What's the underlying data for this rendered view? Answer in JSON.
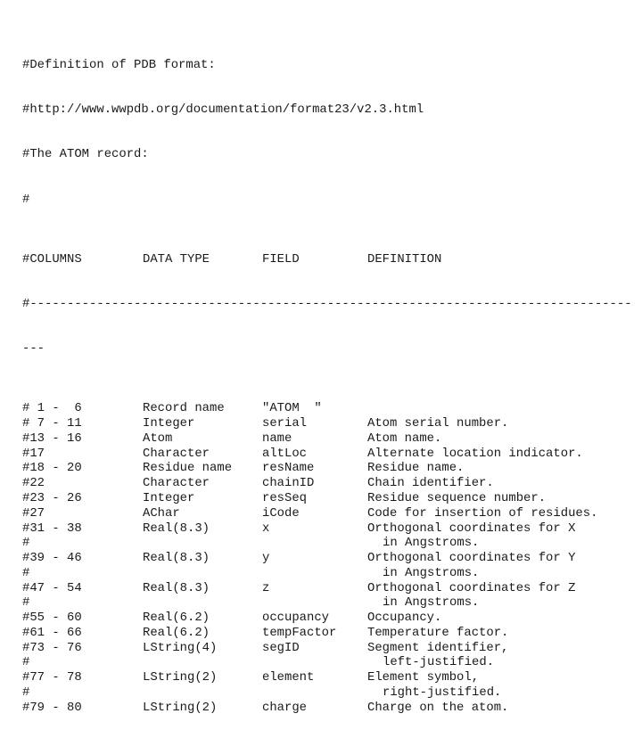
{
  "header": {
    "lines": [
      "#Definition of PDB format:",
      "#http://www.wwpdb.org/documentation/format23/v2.3.html",
      "#The ATOM record:",
      "#"
    ]
  },
  "table": {
    "columns_header": {
      "columns": "#COLUMNS",
      "data_type": "DATA TYPE",
      "field": "FIELD",
      "definition": "DEFINITION"
    },
    "rule": "#---------------------------------------------------------------------------------",
    "rule_wrap": "---",
    "rows": [
      {
        "columns": "# 1 -  6",
        "data_type": "Record name",
        "field": "\"ATOM  \"",
        "definition": ""
      },
      {
        "columns": "# 7 - 11",
        "data_type": "Integer",
        "field": "serial",
        "definition": "Atom serial number."
      },
      {
        "columns": "#13 - 16",
        "data_type": "Atom",
        "field": "name",
        "definition": "Atom name."
      },
      {
        "columns": "#17",
        "data_type": "Character",
        "field": "altLoc",
        "definition": "Alternate location indicator."
      },
      {
        "columns": "#18 - 20",
        "data_type": "Residue name",
        "field": "resName",
        "definition": "Residue name."
      },
      {
        "columns": "#22",
        "data_type": "Character",
        "field": "chainID",
        "definition": "Chain identifier."
      },
      {
        "columns": "#23 - 26",
        "data_type": "Integer",
        "field": "resSeq",
        "definition": "Residue sequence number."
      },
      {
        "columns": "#27",
        "data_type": "AChar",
        "field": "iCode",
        "definition": "Code for insertion of residues."
      },
      {
        "columns": "#31 - 38",
        "data_type": "Real(8.3)",
        "field": "x",
        "definition": "Orthogonal coordinates for X"
      },
      {
        "columns": "#",
        "data_type": "",
        "field": "",
        "definition": "",
        "continuation": "in Angstroms."
      },
      {
        "columns": "#39 - 46",
        "data_type": "Real(8.3)",
        "field": "y",
        "definition": "Orthogonal coordinates for Y"
      },
      {
        "columns": "#",
        "data_type": "",
        "field": "",
        "definition": "",
        "continuation": "in Angstroms."
      },
      {
        "columns": "#47 - 54",
        "data_type": "Real(8.3)",
        "field": "z",
        "definition": "Orthogonal coordinates for Z"
      },
      {
        "columns": "#",
        "data_type": "",
        "field": "",
        "definition": "",
        "continuation": "in Angstroms."
      },
      {
        "columns": "#55 - 60",
        "data_type": "Real(6.2)",
        "field": "occupancy",
        "definition": "Occupancy."
      },
      {
        "columns": "#61 - 66",
        "data_type": "Real(6.2)",
        "field": "tempFactor",
        "definition": "Temperature factor."
      },
      {
        "columns": "#73 - 76",
        "data_type": "LString(4)",
        "field": "segID",
        "definition": "Segment identifier,"
      },
      {
        "columns": "#",
        "data_type": "",
        "field": "",
        "definition": "",
        "continuation": "left-justified."
      },
      {
        "columns": "#77 - 78",
        "data_type": "LString(2)",
        "field": "element",
        "definition": "Element symbol,"
      },
      {
        "columns": "#",
        "data_type": "",
        "field": "",
        "definition": "",
        "continuation": "right-justified."
      },
      {
        "columns": "#79 - 80",
        "data_type": "LString(2)",
        "field": "charge",
        "definition": "Charge on the atom."
      }
    ]
  }
}
